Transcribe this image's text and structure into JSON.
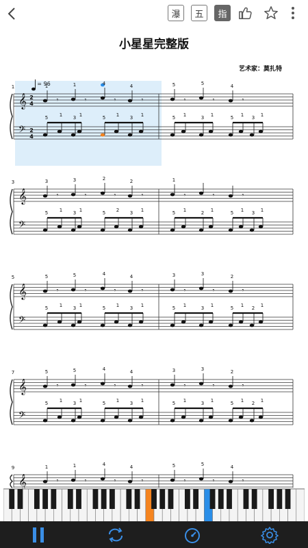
{
  "toolbar": {
    "btn_pedal": "瀑",
    "btn_staff": "五",
    "btn_finger": "指"
  },
  "score": {
    "title": "小星星完整版",
    "composer_label": "艺术家：",
    "composer_name": "莫扎特",
    "tempo": "= 96",
    "systems": [
      {
        "measure_number": "1",
        "rh_fingers": [
          "1",
          "1",
          "4",
          "4",
          "5",
          "5",
          "4"
        ],
        "lh_fingers": [
          "5",
          "1",
          "3",
          "1",
          "5",
          "1",
          "3",
          "1",
          "5",
          "1",
          "3",
          "1",
          "5",
          "1",
          "3",
          "1"
        ]
      },
      {
        "measure_number": "3",
        "rh_fingers": [
          "3",
          "3",
          "2",
          "2",
          "1"
        ],
        "lh_fingers": [
          "5",
          "1",
          "3",
          "1",
          "5",
          "2",
          "3",
          "1",
          "5",
          "1",
          "2",
          "1",
          "5",
          "1",
          "3",
          "1"
        ]
      },
      {
        "measure_number": "5",
        "rh_fingers": [
          "5",
          "5",
          "4",
          "4",
          "3",
          "3",
          "2"
        ],
        "lh_fingers": [
          "5",
          "1",
          "3",
          "1",
          "5",
          "1",
          "3",
          "1",
          "5",
          "1",
          "3",
          "1",
          "5",
          "1",
          "2",
          "1"
        ]
      },
      {
        "measure_number": "7",
        "rh_fingers": [
          "5",
          "5",
          "4",
          "4",
          "3",
          "3",
          "2"
        ],
        "lh_fingers": [
          "5",
          "1",
          "3",
          "1",
          "5",
          "1",
          "3",
          "1",
          "5",
          "1",
          "3",
          "1",
          "5",
          "1",
          "2",
          "1"
        ]
      },
      {
        "measure_number": "9",
        "rh_fingers": [
          "1",
          "1",
          "4",
          "4",
          "5",
          "5",
          "4"
        ],
        "lh_fingers": []
      }
    ]
  },
  "colors": {
    "highlight": "#ddeefa",
    "active_note": "#f5841f",
    "current_note_blue": "#2a8ee8",
    "bottom_bar": "#1e1e1e",
    "accent": "#3a8ee6"
  },
  "bottom": {
    "pause": "pause-icon",
    "loop": "loop-icon",
    "speed": "speedometer-icon",
    "settings": "settings-icon"
  }
}
